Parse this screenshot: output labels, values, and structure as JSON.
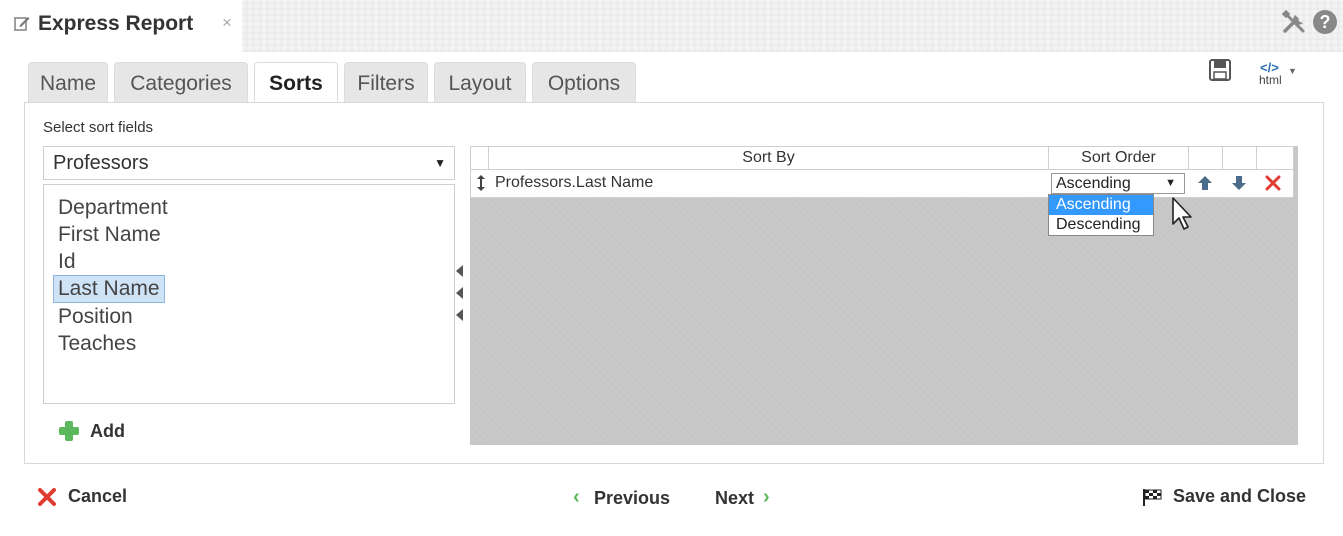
{
  "window": {
    "title": "Express Report",
    "close_glyph": "×"
  },
  "header_icons": [
    "edit-icon",
    "tools-icon",
    "help-icon"
  ],
  "help_glyph": "?",
  "tabs": [
    {
      "label": "Name",
      "active": false
    },
    {
      "label": "Categories",
      "active": false
    },
    {
      "label": "Sorts",
      "active": true
    },
    {
      "label": "Filters",
      "active": false
    },
    {
      "label": "Layout",
      "active": false
    },
    {
      "label": "Options",
      "active": false
    }
  ],
  "toolbar": {
    "icons": [
      "save-icon",
      "html-export-icon"
    ],
    "html_label": "html",
    "html_tag": "</>"
  },
  "sort_fields": {
    "label": "Select sort fields",
    "table_select": "Professors",
    "fields": [
      "Department",
      "First Name",
      "Id",
      "Last Name",
      "Position",
      "Teaches"
    ],
    "selected_field": "Last Name",
    "add_label": "Add"
  },
  "sort_grid": {
    "columns": {
      "sort_by": "Sort By",
      "sort_order": "Sort Order"
    },
    "rows": [
      {
        "field": "Professors.Last Name",
        "order": "Ascending"
      }
    ],
    "order_options": [
      "Ascending",
      "Descending"
    ],
    "highlighted_option": "Ascending"
  },
  "footer": {
    "cancel": "Cancel",
    "previous": "Previous",
    "next": "Next",
    "save_close": "Save and Close"
  },
  "colors": {
    "accent_green": "#5cb85c",
    "delete_red": "#e03c31",
    "highlight_blue": "#3399ff",
    "selected_item_bg": "#cfe3f7"
  }
}
